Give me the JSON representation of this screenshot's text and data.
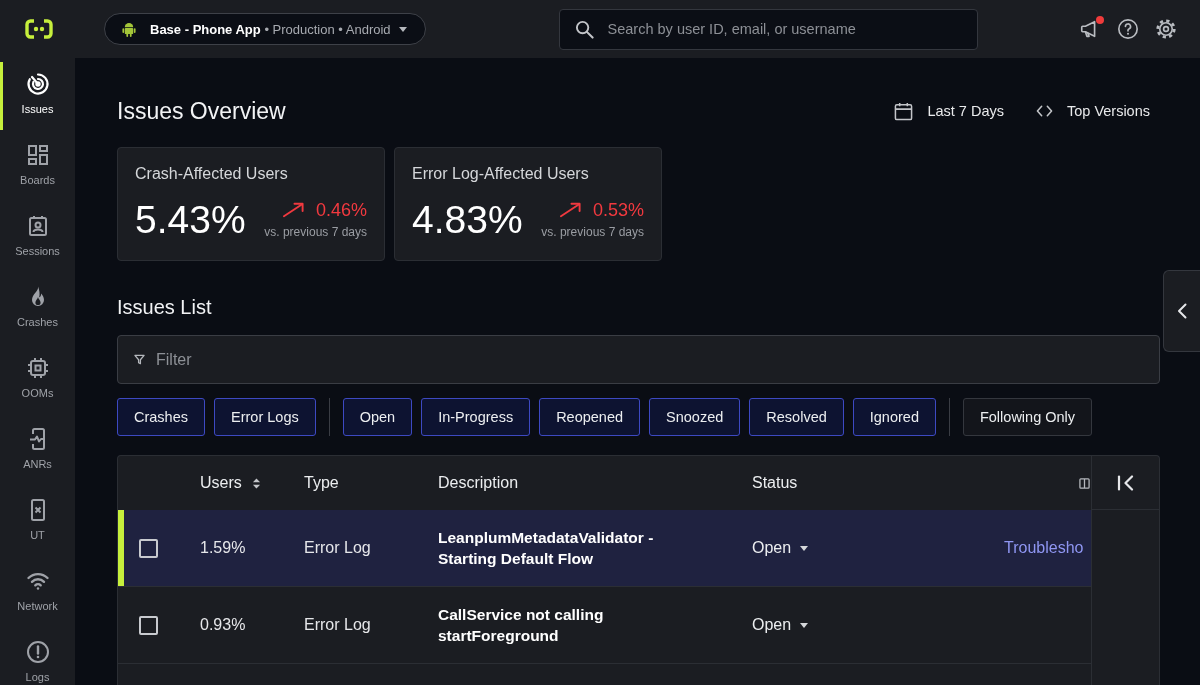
{
  "top_bar": {
    "app_context": "**Base - Phone App** • Production • Android",
    "search": {
      "placeholder": "Search by user ID, email, or username"
    },
    "has_unread": true
  },
  "sidebar": {
    "items": [
      {
        "label": "Issues",
        "selected": true
      },
      {
        "label": "Boards",
        "selected": false
      },
      {
        "label": "Sessions",
        "selected": false
      },
      {
        "label": "Crashes",
        "selected": false
      },
      {
        "label": "OOMs",
        "selected": false
      },
      {
        "label": "ANRs",
        "selected": false
      },
      {
        "label": "UT",
        "selected": false
      },
      {
        "label": "Network",
        "selected": false
      },
      {
        "label": "Logs",
        "selected": false
      }
    ]
  },
  "header": {
    "title": "Issues Overview",
    "date_range": "Last 7 Days",
    "versions": "Top Versions"
  },
  "stats": [
    {
      "label": "Crash-Affected Users",
      "value": "5.43%",
      "rising": true,
      "change": "0.46%",
      "comparison": "vs. previous 7 days"
    },
    {
      "label": "Error Log-Affected Users",
      "value": "4.83%",
      "rising": true,
      "change": "0.53%",
      "comparison": "vs. previous 7 days"
    }
  ],
  "issues_list": {
    "title": "Issues List",
    "filter": {
      "placeholder": "Filter"
    },
    "chip_groups": [
      {
        "chips": [
          {
            "label": "Crashes",
            "selected": true
          },
          {
            "label": "Error Logs",
            "selected": true
          }
        ]
      },
      {
        "chips": [
          {
            "label": "Open",
            "selected": true
          },
          {
            "label": "In-Progress",
            "selected": true
          },
          {
            "label": "Reopened",
            "selected": true
          },
          {
            "label": "Snoozed",
            "selected": true
          },
          {
            "label": "Resolved",
            "selected": true
          },
          {
            "label": "Ignored",
            "selected": true
          }
        ]
      },
      {
        "chips": [
          {
            "label": "Following Only",
            "selected": false
          }
        ]
      }
    ]
  },
  "table": {
    "columns": [
      {
        "label": "Users",
        "sortable": true
      },
      {
        "label": "Type",
        "sortable": false
      },
      {
        "label": "Description",
        "sortable": false
      },
      {
        "label": "Status",
        "sortable": false
      }
    ],
    "rows": [
      {
        "selected": true,
        "checked": false,
        "users": "1.59%",
        "type": "Error Log",
        "description": "LeanplumMetadataValidator - Starting Default Flow",
        "status": "Open",
        "action": "Troublesho"
      },
      {
        "selected": false,
        "checked": false,
        "users": "0.93%",
        "type": "Error Log",
        "description": "CallService not calling startForeground",
        "status": "Open"
      }
    ]
  }
}
